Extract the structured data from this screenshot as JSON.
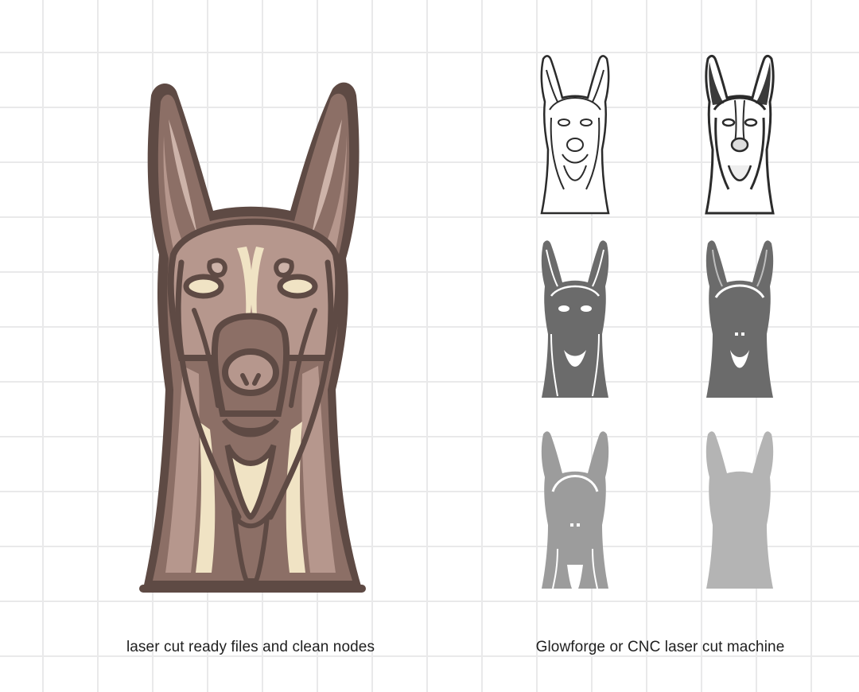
{
  "captions": {
    "left": "laser cut ready files and clean nodes",
    "right": "Glowforge or CNC laser cut machine"
  },
  "colors": {
    "background": "#ffffff",
    "grid": "#e9e9ea",
    "outline_dark": "#5e4a44",
    "layer_mid": "#8c6f66",
    "layer_light": "#b6978d",
    "layer_pale": "#cdb3a9",
    "layer_cream": "#f0e3c4",
    "thumb_line": "#2b2b2b",
    "thumb_gray": "#6b6b6b",
    "thumb_light": "#9c9c9c",
    "thumb_pale": "#b4b4b4"
  },
  "thumbnails": [
    {
      "name": "line-only",
      "style": "outline"
    },
    {
      "name": "line-with-ear-fill",
      "style": "outline-fill"
    },
    {
      "name": "dark-layer",
      "style": "dark"
    },
    {
      "name": "mid-layer",
      "style": "mid"
    },
    {
      "name": "gray-layer",
      "style": "gray"
    },
    {
      "name": "silhouette",
      "style": "silhouette"
    }
  ]
}
